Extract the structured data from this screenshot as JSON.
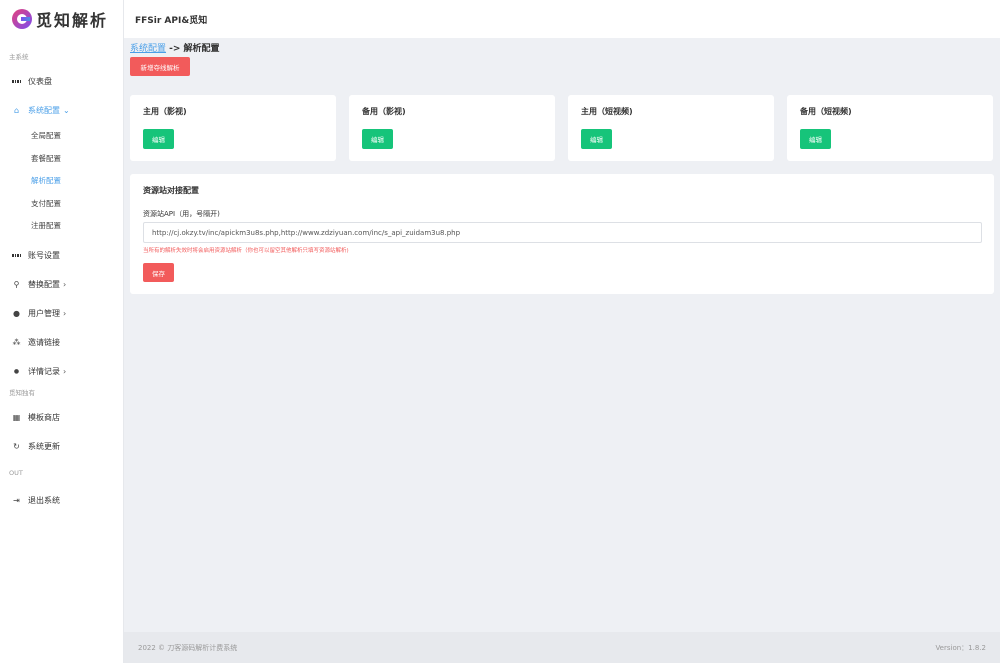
{
  "app": {
    "logo_text": "觅知解析",
    "header_title": "FFSir API&觅知"
  },
  "sidebar": {
    "section_main": "主系统",
    "dashboard": "仪表盘",
    "system_config": "系统配置",
    "sub_items": [
      "全局配置",
      "套餐配置",
      "解析配置",
      "支付配置",
      "注册配置"
    ],
    "account_settings": "账号设置",
    "replace_config": "替换配置",
    "user_management": "用户管理",
    "invite_link": "邀请链接",
    "detail_records": "详情记录",
    "section_mizhi": "觅知独有",
    "template_store": "模板商店",
    "system_update": "系统更新",
    "section_out": "OUT",
    "logout": "退出系统"
  },
  "breadcrumb": {
    "link": "系统配置",
    "current": " -> 解析配置"
  },
  "add_button": "新增夺线解析",
  "cards": [
    {
      "title": "主用（影视)",
      "button": "编辑"
    },
    {
      "title": "备用（影视)",
      "button": "编辑"
    },
    {
      "title": "主用（短视频)",
      "button": "编辑"
    },
    {
      "title": "备用（短视频)",
      "button": "编辑"
    }
  ],
  "panel": {
    "title": "资源站对接配置",
    "field_label": "资源站API（用，号隔开)",
    "field_value": "http://cj.okzy.tv/inc/apickm3u8s.php,http://www.zdziyuan.com/inc/s_api_zuidam3u8.php",
    "hint": "当所有的解析失效时将会启用资源站解析（你也可以留空其他解析只填写资源站解析)",
    "save_button": "保存"
  },
  "footer": {
    "copyright": "2022 © 刀客源码解析计费系统",
    "version": "Version：1.8.2"
  },
  "colors": {
    "accent_blue": "#4a9fe8",
    "danger_red": "#f25b5b",
    "success_green": "#16c47a"
  }
}
